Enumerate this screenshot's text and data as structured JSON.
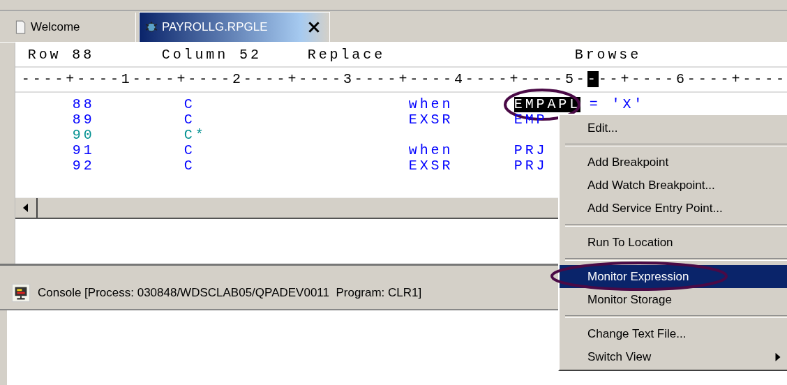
{
  "tabs": [
    {
      "label": "Welcome",
      "selected": false,
      "kind": "page"
    },
    {
      "label": "PAYROLLG.RPGLE",
      "selected": true,
      "kind": "source"
    }
  ],
  "editor": {
    "status": {
      "row": "Row 88",
      "column": "Column 52",
      "mode": "Replace",
      "view": "Browse"
    },
    "ruler": {
      "before": "----+----1----+----2----+----3----+----4----+----5-",
      "cursor": "-",
      "after": "--+----6----+----"
    },
    "lines": [
      {
        "number": "88",
        "spec": "C",
        "opcode": "when",
        "factor": {
          "text": "EMPAPL",
          "selected": true,
          "circled": true
        },
        "rest": "= 'X'",
        "kind": "code"
      },
      {
        "number": "89",
        "spec": "C",
        "opcode": "EXSR",
        "factor": {
          "text": "EMP",
          "selected": false,
          "circled": false
        },
        "kind": "code"
      },
      {
        "number": "90",
        "spec": "C*",
        "kind": "comment"
      },
      {
        "number": "91",
        "spec": "C",
        "opcode": "when",
        "factor": {
          "text": "PRJ",
          "selected": false,
          "circled": false
        },
        "kind": "code"
      },
      {
        "number": "92",
        "spec": "C",
        "opcode": "EXSR",
        "factor": {
          "text": "PRJ",
          "selected": false,
          "circled": false
        },
        "kind": "code"
      }
    ]
  },
  "console": {
    "title": "Console [Process: 030848/WDSCLAB05/QPADEV0011  Program: CLR1]"
  },
  "context_menu": [
    {
      "kind": "item",
      "label": "Edit...",
      "selected": false,
      "circled": false
    },
    {
      "kind": "separator"
    },
    {
      "kind": "item",
      "label": "Add Breakpoint",
      "selected": false,
      "circled": false
    },
    {
      "kind": "item",
      "label": "Add Watch Breakpoint...",
      "selected": false,
      "circled": false
    },
    {
      "kind": "item",
      "label": "Add Service Entry Point...",
      "selected": false,
      "circled": false
    },
    {
      "kind": "separator"
    },
    {
      "kind": "item",
      "label": "Run To Location",
      "selected": false,
      "circled": false
    },
    {
      "kind": "separator"
    },
    {
      "kind": "item",
      "label": "Monitor Expression",
      "selected": true,
      "circled": true
    },
    {
      "kind": "item",
      "label": "Monitor Storage",
      "selected": false,
      "circled": false
    },
    {
      "kind": "separator"
    },
    {
      "kind": "item",
      "label": "Change Text File...",
      "selected": false,
      "circled": false
    },
    {
      "kind": "submenu",
      "label": "Switch View",
      "selected": false,
      "circled": false
    }
  ]
}
